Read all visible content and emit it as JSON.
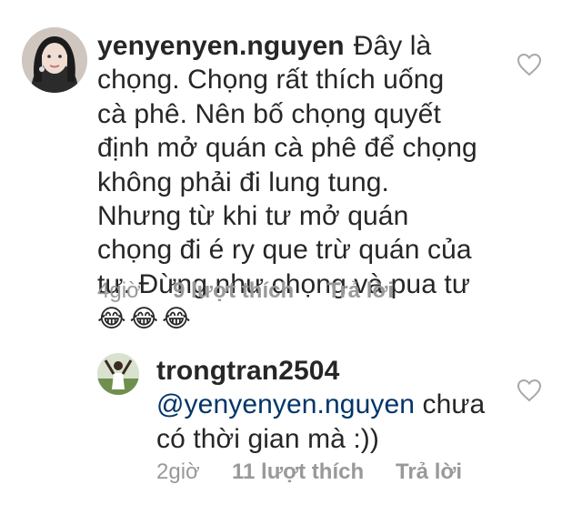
{
  "comments": [
    {
      "username": "yenyenyen.nguyen",
      "text": "Đây là chọng. Chọng rất thích uống cà phê. Nên bố chọng quyết định mở quán cà phê để chọng không phải đi lung tung. Nhưng từ khi tư mở quán chọng đi é ry que trừ quán của tư. Đừng như chọng và pua tư",
      "emojis": "😂😂😂",
      "time": "4giờ",
      "likes": "9 lượt thích",
      "reply": "Trả lời",
      "avatar_icon": "user-avatar"
    },
    {
      "username": "trongtran2504",
      "mention": "@yenyenyen.nguyen",
      "text": "chưa có thời gian mà :))",
      "time": "2giờ",
      "likes": "11 lượt thích",
      "reply": "Trả lời",
      "avatar_icon": "user-avatar"
    }
  ],
  "icons": {
    "like": "heart-outline-icon"
  },
  "colors": {
    "text": "#262626",
    "meta": "#999999",
    "mention": "#003569",
    "icon": "#a8a8a8"
  }
}
